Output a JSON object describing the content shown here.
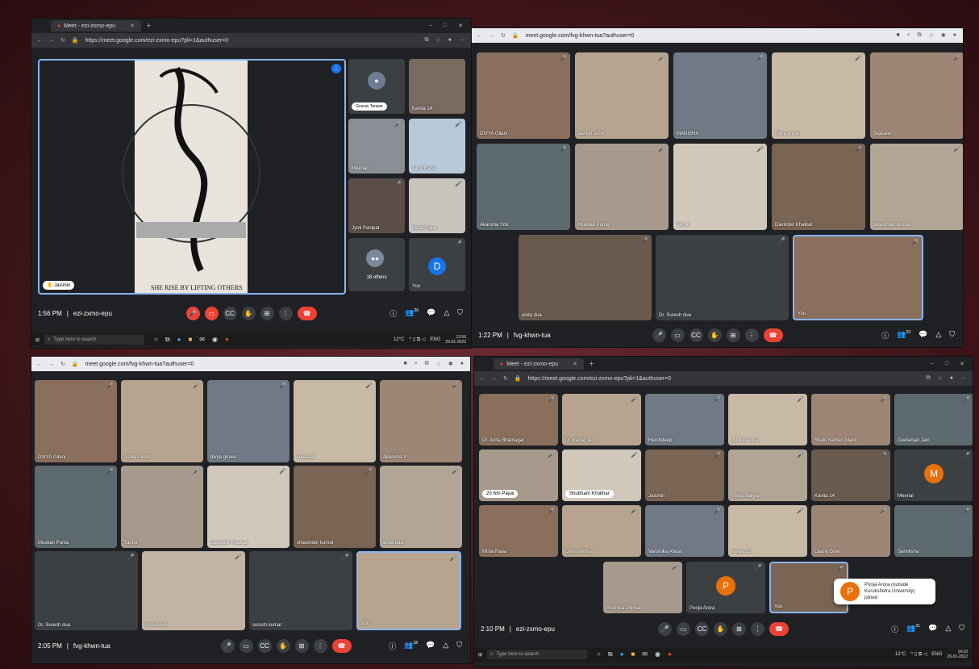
{
  "colors": {
    "meet_bg": "#202124",
    "tile": "#3c4043",
    "red": "#ea4335",
    "accent": "#8ab4f8",
    "orange": "#e8710a"
  },
  "panel1": {
    "tab_title": "Meet - ezi-zxmo-epu",
    "url": "https://meet.google.com/ezi-zxmo-epu?pli=1&authuser=0",
    "tiles": [
      "Gourav Tanwar",
      "Kavita 14",
      "Meenal",
      "Tanu Rana",
      "Jyoti Panipat",
      "Minal Rana",
      "You"
    ],
    "others_label": "18 others",
    "you_initial": "D",
    "presenter": "Jaismin",
    "time": "1:56 PM",
    "meeting_code": "ezi-zxmo-epu",
    "badge_count": "26",
    "taskbar_search": "Type here to search",
    "weather": "12°C",
    "lang": "ENG",
    "clock_time": "13:56",
    "clock_date": "29-01-2022"
  },
  "panel2": {
    "url": "meet.google.com/fvg-khwn-tua?authuser=0",
    "tiles": [
      "DIVYA Gilani",
      "ashish sobti",
      "MANISHA",
      "divya grover",
      "Tejasavi",
      "Akansha Ydv",
      "Muskan Punia",
      "Tannu",
      "Davinder Khatkar",
      "shlavinder kumar",
      "anita dua",
      "Dr. Suresh dua",
      "You"
    ],
    "time": "1:22 PM",
    "meeting_code": "fvg-khwn-tua",
    "badge_count": "23"
  },
  "panel3": {
    "url": "meet.google.com/fvg-khwn-tua?authuser=0",
    "tiles": [
      "DIVYA Gilani",
      "ashish sobti",
      "divya grover",
      "Tejasavi",
      "Akansha Y",
      "Muskan Punia",
      "Tannu",
      "Davinder Khatkar",
      "shlavinder kumar",
      "anita dua",
      "Dr. Suresh dua",
      "MANISHA",
      "suresh kumar",
      "You"
    ],
    "time": "2:05 PM",
    "meeting_code": "fvg-khwn-tua",
    "badge_count": "18"
  },
  "panel4": {
    "tab_title": "Meet - ezi-zxmo-epu",
    "url": "https://meet.google.com/ezi-zxmo-epu?pli=1&authuser=0",
    "tiles": [
      "Dr. Anita Bhatnagar",
      "Dr.pranay jain",
      "Harshdeep",
      "Jyoti Panipat",
      "Shalu Kamal Gilani",
      "Geetanjali Jain",
      "20 Nm Payal",
      "Shubham Khokhar",
      "Jaismin",
      "Vijeta Baliyan",
      "Kavita 14",
      "Meenal",
      "Minal Rana",
      "Divya Verma",
      "Vanshika Ahuja",
      "Neeru 23",
      "Ojasvi Goel",
      "Samiksha",
      "Ruchika Dhiman",
      "Pooja Arora",
      "You"
    ],
    "meenal_initial": "M",
    "pooja_initial": "P",
    "toast_initial": "P",
    "toast_text": "Pooja Arora (outside Kurukshetra University) joined",
    "time": "2:10 PM",
    "meeting_code": "ezi-zxmo-epu",
    "badge_count": "21",
    "taskbar_search": "Type here to search",
    "weather": "12°C",
    "lang": "ENG",
    "clock_time": "14:10",
    "clock_date": "29-01-2022"
  }
}
